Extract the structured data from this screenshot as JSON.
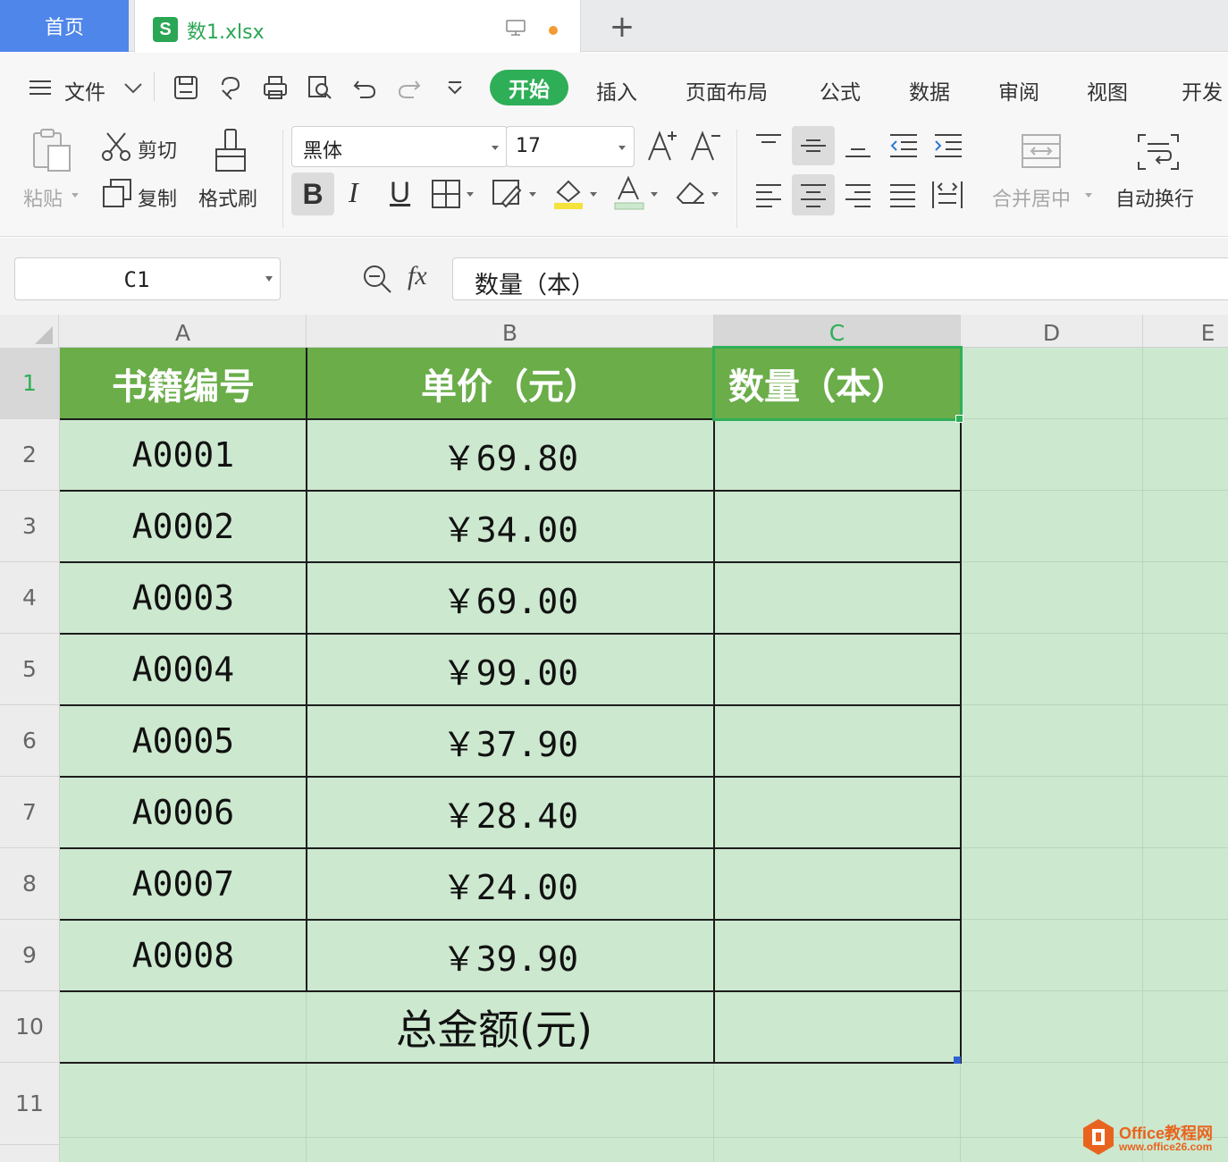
{
  "tabs": {
    "home_label": "首页",
    "file_icon_letter": "S",
    "file_name": "数1.xlsx",
    "new_tab_symbol": "+"
  },
  "menu": {
    "file_label": "文件",
    "items": [
      "开始",
      "插入",
      "页面布局",
      "公式",
      "数据",
      "审阅",
      "视图",
      "开发"
    ]
  },
  "ribbon": {
    "paste_label": "粘贴",
    "cut_label": "剪切",
    "copy_label": "复制",
    "format_painter_label": "格式刷",
    "font_name": "黑体",
    "font_size": "17",
    "bold_label": "B",
    "italic_label": "I",
    "underline_label": "U",
    "merge_label": "合并居中",
    "wrap_label": "自动换行"
  },
  "formula_bar": {
    "name_box": "C1",
    "fx_label": "fx",
    "content": "数量（本）"
  },
  "sheet": {
    "columns": [
      "A",
      "B",
      "C",
      "D",
      "E"
    ],
    "rows": [
      "1",
      "2",
      "3",
      "4",
      "5",
      "6",
      "7",
      "8",
      "9",
      "10",
      "11"
    ],
    "header": [
      "书籍编号",
      "单价（元）",
      "数量（本）"
    ],
    "data": [
      {
        "id": "A0001",
        "price": "￥69.80"
      },
      {
        "id": "A0002",
        "price": "￥34.00"
      },
      {
        "id": "A0003",
        "price": "￥69.00"
      },
      {
        "id": "A0004",
        "price": "￥99.00"
      },
      {
        "id": "A0005",
        "price": "￥37.90"
      },
      {
        "id": "A0006",
        "price": "￥28.40"
      },
      {
        "id": "A0007",
        "price": "￥24.00"
      },
      {
        "id": "A0008",
        "price": "￥39.90"
      }
    ],
    "total_label": "总金额(元)",
    "selected_cell": "C1"
  },
  "watermark": {
    "title": "Office教程网",
    "url": "www.office26.com"
  },
  "colors": {
    "accent_green": "#2fae58",
    "header_fill": "#6aad49",
    "sheet_bg": "#cce8cf",
    "home_tab": "#4f86ea"
  }
}
